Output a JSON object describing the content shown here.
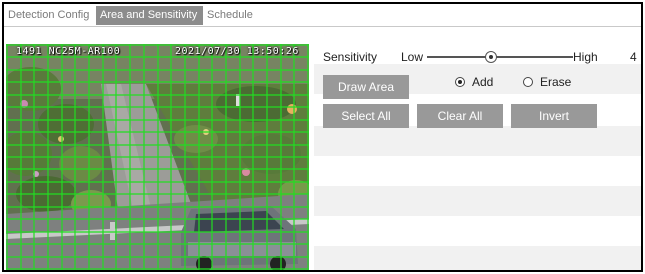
{
  "tabs": [
    {
      "label": "Detection Config",
      "active": false
    },
    {
      "label": "Area and Sensitivity",
      "active": true
    },
    {
      "label": "Schedule",
      "active": false
    }
  ],
  "preview": {
    "osd_left": "1491  NC25M-AR100",
    "osd_right": "2021/07/30 13:50:26",
    "grid_color": "#22dd22",
    "grid_columns": 22,
    "grid_rows": 18
  },
  "sensitivity": {
    "label": "Sensitivity",
    "low_label": "Low",
    "high_label": "High",
    "value": "4",
    "level_fraction": 0.43
  },
  "mode": {
    "draw_area_label": "Draw Area",
    "add_label": "Add",
    "erase_label": "Erase",
    "selected": "add"
  },
  "actions": {
    "select_all_label": "Select All",
    "clear_all_label": "Clear All",
    "invert_label": "Invert"
  },
  "colors": {
    "button_bg": "#999999",
    "tab_active_bg": "#8c8c8c",
    "stripe_bg": "#f1f1f1"
  }
}
